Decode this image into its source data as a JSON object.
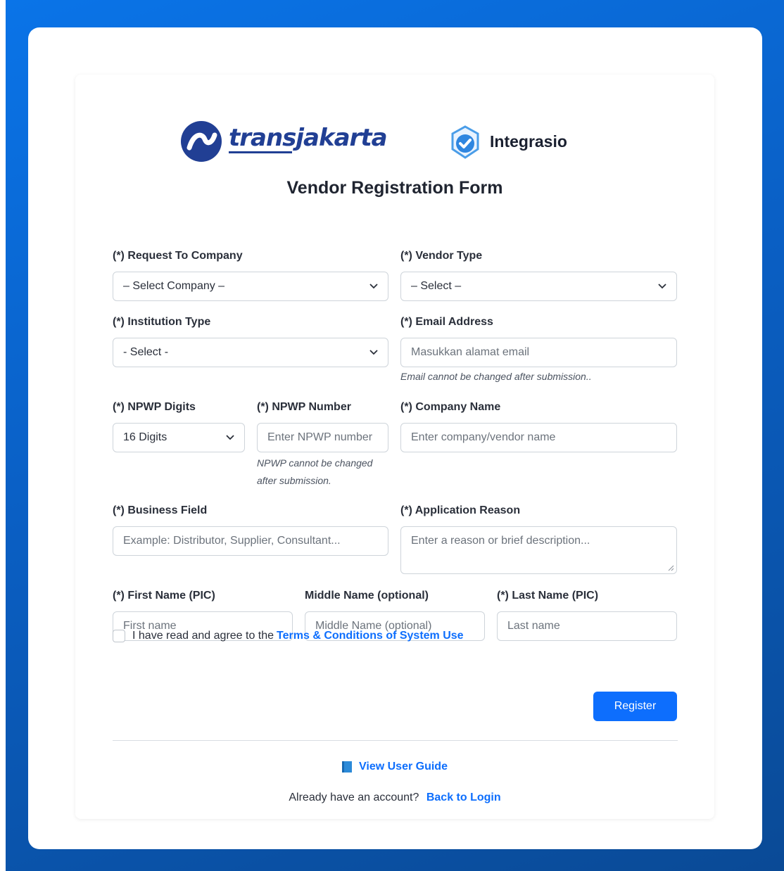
{
  "logos": {
    "transjakarta": "transjakarta",
    "integrasio": "Integrasio"
  },
  "title": "Vendor Registration Form",
  "fields": {
    "request_company": {
      "label": "(*) Request To Company",
      "value": "– Select Company –"
    },
    "vendor_type": {
      "label": "(*) Vendor Type",
      "value": "– Select –"
    },
    "institution_type": {
      "label": "(*) Institution Type",
      "value": "- Select -"
    },
    "email": {
      "label": "(*) Email Address",
      "placeholder": "Masukkan alamat email",
      "hint": "Email cannot be changed after submission.."
    },
    "npwp_digits": {
      "label": "(*) NPWP Digits",
      "value": "16 Digits"
    },
    "npwp_number": {
      "label": "(*) NPWP Number",
      "placeholder": "Enter NPWP number",
      "hint": "NPWP cannot be changed after submission."
    },
    "company_name": {
      "label": "(*) Company Name",
      "placeholder": "Enter company/vendor name"
    },
    "business_field": {
      "label": "(*) Business Field",
      "placeholder": "Example: Distributor, Supplier, Consultant..."
    },
    "application_reason": {
      "label": "(*) Application Reason",
      "placeholder": "Enter a reason or brief description..."
    },
    "first_name": {
      "label": "(*) First Name (PIC)",
      "placeholder": "First name"
    },
    "middle_name": {
      "label": "Middle Name (optional)",
      "placeholder": "Middle Name (optional)"
    },
    "last_name": {
      "label": "(*) Last Name (PIC)",
      "placeholder": "Last name"
    }
  },
  "terms": {
    "text": "I have read and agree to the ",
    "link": "Terms & Conditions of System Use"
  },
  "register_button": "Register",
  "user_guide": "View User Guide",
  "login": {
    "text": "Already have an account?",
    "link": "Back to Login"
  },
  "colors": {
    "accent": "#0d6efd",
    "brand_navy": "#213f94",
    "background": "#0a66d8"
  }
}
